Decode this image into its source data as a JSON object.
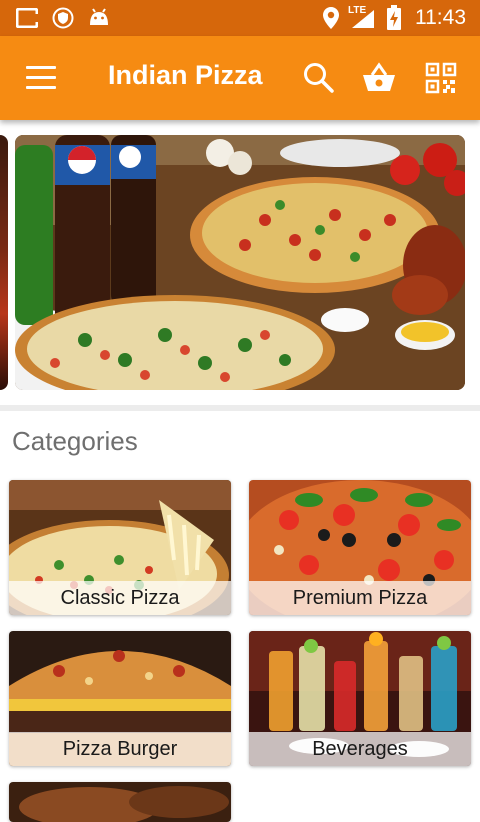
{
  "status_bar": {
    "time": "11:43",
    "network": "LTE",
    "icons": [
      "app-c-icon",
      "shield-icon",
      "android-icon",
      "location-icon",
      "signal-icon",
      "battery-icon"
    ]
  },
  "app_bar": {
    "title": "Indian Pizza",
    "icons": [
      "menu-icon",
      "search-icon",
      "basket-icon",
      "qr-code-icon"
    ],
    "color": "#f68b12"
  },
  "banner": {
    "description_icons": [
      "pepsi-bottles",
      "pizzas",
      "chicken-wings",
      "dips"
    ]
  },
  "categories": {
    "heading": "Categories",
    "items": [
      {
        "label": "Classic Pizza"
      },
      {
        "label": "Premium Pizza"
      },
      {
        "label": "Pizza Burger"
      },
      {
        "label": "Beverages"
      }
    ]
  },
  "colors": {
    "status_bar": "#d6670b",
    "app_bar": "#f68b12",
    "heading_text": "#6f6f6f"
  }
}
